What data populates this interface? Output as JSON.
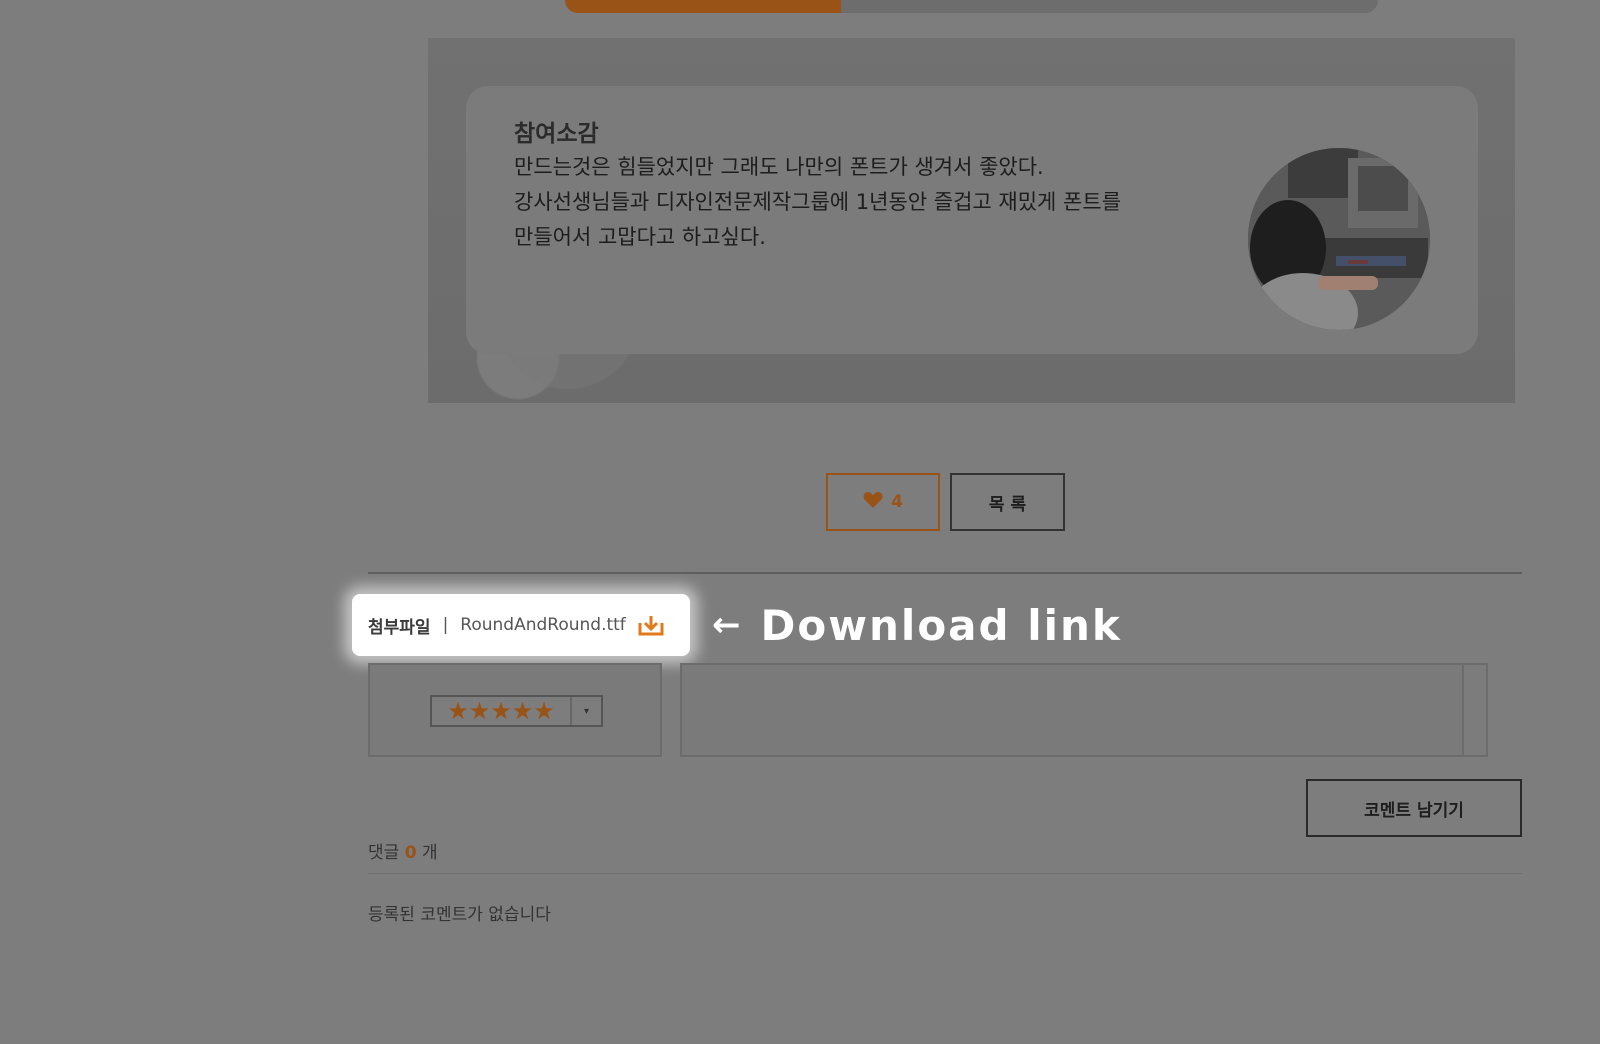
{
  "top_progress": {
    "fill_fraction": 0.34,
    "color": "#9a5317"
  },
  "review": {
    "title": "참여소감",
    "lines": [
      "만드는것은 힘들었지만 그래도 나만의 폰트가 생겨서 좋았다.",
      "강사선생님들과 디자인전문제작그룹에 1년동안 즐겁고 재밌게 폰트를",
      "만들어서 고맙다고 하고싶다."
    ],
    "avatar_icon": "participant-photo"
  },
  "actions": {
    "like_icon": "heart-icon",
    "like_count": "4",
    "list_label": "목 록"
  },
  "attachment": {
    "label": "첨부파일",
    "separator": "|",
    "filename": "RoundAndRound.ttf",
    "download_icon": "download-icon"
  },
  "annotation": {
    "arrow": "←",
    "text": "Download link"
  },
  "comment_form": {
    "rating_stars": "★★★★★",
    "rating_value": 5,
    "rating_caret": "▾",
    "submit_label": "코멘트 남기기"
  },
  "comments": {
    "prefix": "댓글",
    "count": "0",
    "suffix": "개",
    "empty_text": "등록된 코멘트가 없습니다"
  },
  "colors": {
    "accent": "#9a5317",
    "overlay_bg": "#7d7d7d",
    "highlight": "#ffffff"
  }
}
